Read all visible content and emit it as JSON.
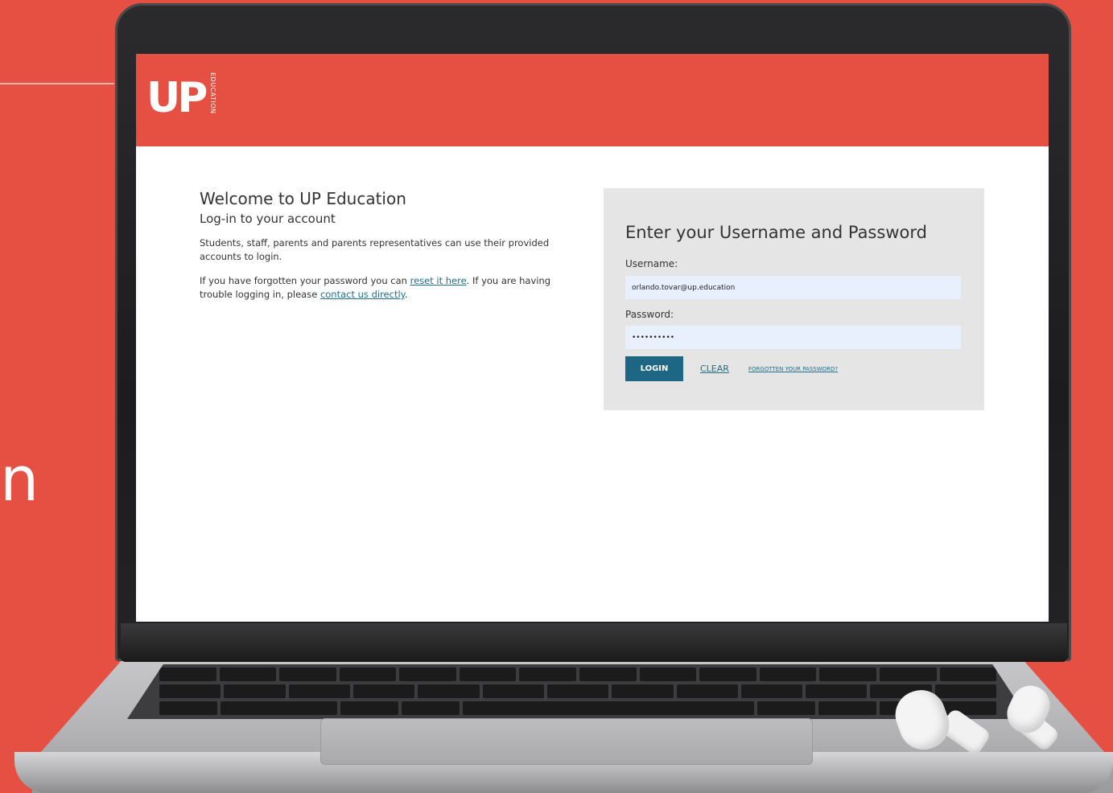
{
  "background": {
    "accent": "#e55043",
    "partial_text": "n"
  },
  "header": {
    "logo_text": "UP",
    "logo_sub": "EDUCATION",
    "color": "#e55043"
  },
  "intro": {
    "title": "Welcome to UP Education",
    "subtitle": "Log-in to your account",
    "paragraph1": "Students, staff, parents and parents representatives can use their provided accounts to login.",
    "paragraph2_before": "If you have forgotten your password you can ",
    "reset_link": "reset it here",
    "paragraph2_middle": ". If you are having trouble logging in, please ",
    "contact_link": "contact us directly",
    "paragraph2_after": "."
  },
  "login": {
    "title": "Enter your Username and Password",
    "username_label": "Username:",
    "username_value": "orlando.tovar@up.education",
    "password_label": "Password:",
    "password_value": "••••••••••",
    "login_button": "LOGIN",
    "clear_link": "CLEAR",
    "forgot_link": "FORGOTTEN YOUR PASSWORD?",
    "button_color": "#1d6784",
    "field_color": "#e8f0fe"
  }
}
